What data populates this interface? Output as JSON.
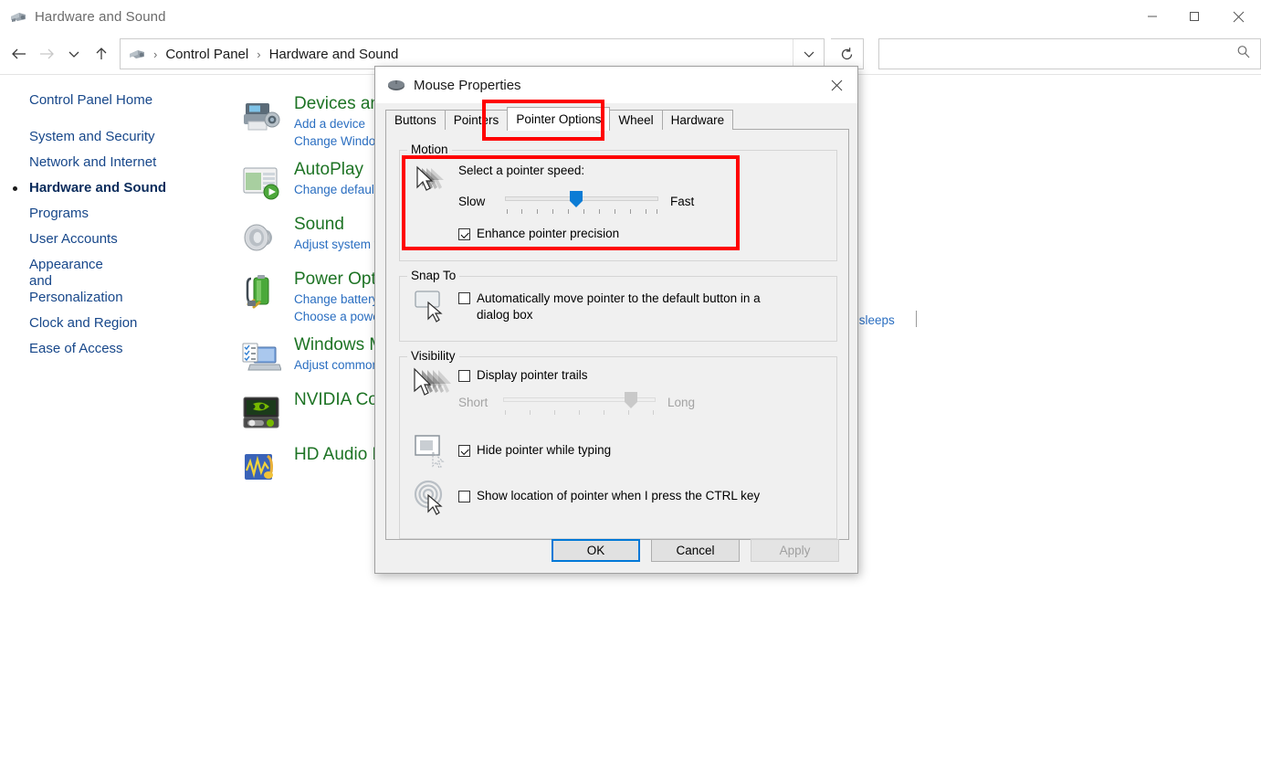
{
  "window": {
    "title": "Hardware and Sound",
    "icon": "hardware-sound-icon",
    "controls": {
      "minimize": "—",
      "maximize": "□",
      "close": "✕"
    }
  },
  "navbar": {
    "back": "←",
    "forward": "→",
    "recent": "∨",
    "up": "↑",
    "dropdown": "∨",
    "refresh": "↻",
    "breadcrumbs": [
      "Control Panel",
      "Hardware and Sound"
    ],
    "separator": "›"
  },
  "search": {
    "value": "",
    "placeholder": "",
    "icon": "search-icon"
  },
  "sidebar": {
    "home": "Control Panel Home",
    "items": [
      {
        "label": "System and Security",
        "active": false
      },
      {
        "label": "Network and Internet",
        "active": false
      },
      {
        "label": "Hardware and Sound",
        "active": true
      },
      {
        "label": "Programs",
        "active": false
      },
      {
        "label": "User Accounts",
        "active": false
      },
      {
        "label": "Appearance and Personalization",
        "active": false
      },
      {
        "label": "Clock and Region",
        "active": false
      },
      {
        "label": "Ease of Access",
        "active": false
      }
    ]
  },
  "categories": [
    {
      "title": "Devices and Printers",
      "icon": "printer-camera-icon",
      "links": [
        "Add a device",
        "Change Windows To Go startup options"
      ]
    },
    {
      "title": "AutoPlay",
      "icon": "autoplay-icon",
      "links": [
        "Change default settings for media or devices"
      ]
    },
    {
      "title": "Sound",
      "icon": "speaker-icon",
      "links": [
        "Adjust system volume"
      ]
    },
    {
      "title": "Power Options",
      "icon": "power-battery-icon",
      "links": [
        "Change battery settings",
        "Choose a power plan"
      ]
    },
    {
      "title": "Windows Mobility Center",
      "icon": "laptop-checklist-icon",
      "links": [
        "Adjust commonly used mobility settings"
      ]
    },
    {
      "title": "NVIDIA Control Panel",
      "icon": "nvidia-icon",
      "links": []
    },
    {
      "title": "HD Audio Manager",
      "icon": "hd-audio-icon",
      "links": []
    }
  ],
  "occluded_right_text": "er sleeps",
  "dialog": {
    "title": "Mouse Properties",
    "icon": "mouse-icon",
    "close": "✕",
    "tabs": [
      {
        "label": "Buttons",
        "selected": false
      },
      {
        "label": "Pointers",
        "selected": false
      },
      {
        "label": "Pointer Options",
        "selected": true
      },
      {
        "label": "Wheel",
        "selected": false
      },
      {
        "label": "Hardware",
        "selected": false
      }
    ],
    "motion": {
      "legend": "Motion",
      "icon": "pointer-speed-icon",
      "speed_label": "Select a pointer speed:",
      "slow_label": "Slow",
      "fast_label": "Fast",
      "slider_value": 6,
      "slider_min": 1,
      "slider_max": 11,
      "enhance_precision_label": "Enhance pointer precision",
      "enhance_precision_checked": true
    },
    "snap_to": {
      "legend": "Snap To",
      "icon": "snap-to-icon",
      "label": "Automatically move pointer to the default button in a dialog box",
      "checked": false
    },
    "visibility": {
      "legend": "Visibility",
      "trails": {
        "icon": "pointer-trails-icon",
        "label": "Display pointer trails",
        "checked": false,
        "short_label": "Short",
        "long_label": "Long",
        "slider_value": 6,
        "slider_min": 1,
        "slider_max": 7,
        "disabled": true
      },
      "hide_typing": {
        "icon": "hide-pointer-typing-icon",
        "label": "Hide pointer while typing",
        "checked": true
      },
      "show_location": {
        "icon": "show-pointer-location-icon",
        "label": "Show location of pointer when I press the CTRL key",
        "checked": false
      }
    },
    "buttons": {
      "ok": "OK",
      "cancel": "Cancel",
      "apply": "Apply",
      "apply_disabled": true
    }
  },
  "highlights": {
    "accent_color": "#ff0000",
    "boxes": [
      "pointer-options-tab",
      "motion-speed-area"
    ]
  },
  "colors": {
    "category_title": "#1d7324",
    "link": "#2a6ec1",
    "nav_link": "#17478a",
    "default_button_border": "#0078d7",
    "highlight": "#ff0000"
  }
}
